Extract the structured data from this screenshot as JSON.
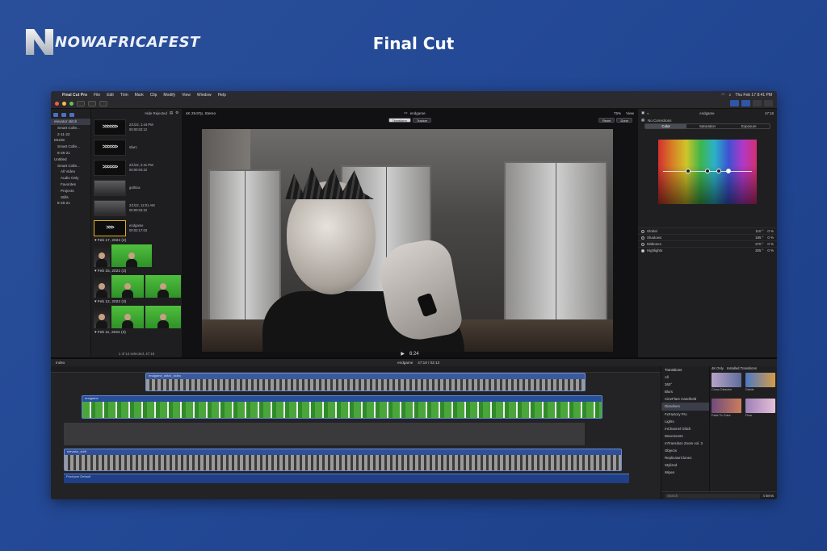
{
  "brand": {
    "name": "NOWAFRICAFEST"
  },
  "page_title": "Final Cut",
  "menubar": {
    "app": "Final Cut Pro",
    "items": [
      "File",
      "Edit",
      "Trim",
      "Mark",
      "Clip",
      "Modify",
      "View",
      "Window",
      "Help"
    ],
    "clock": "Thu Feb 17  8:41 PM"
  },
  "libraries": {
    "rows": [
      {
        "label": "elevator stitch",
        "indent": 0,
        "selected": true
      },
      {
        "label": "Smart Colle...",
        "indent": 1
      },
      {
        "label": "2-11-22",
        "indent": 1
      },
      {
        "label": "MUSE",
        "indent": 0
      },
      {
        "label": "Smart Colle...",
        "indent": 1
      },
      {
        "label": "8-26-21",
        "indent": 1
      },
      {
        "label": "Untitled",
        "indent": 0
      },
      {
        "label": "Smart Colle...",
        "indent": 1
      },
      {
        "label": "All Video",
        "indent": 2
      },
      {
        "label": "Audio Only",
        "indent": 2
      },
      {
        "label": "Favorites",
        "indent": 2
      },
      {
        "label": "Projects",
        "indent": 2
      },
      {
        "label": "Stills",
        "indent": 2
      },
      {
        "label": "8-26-21",
        "indent": 1
      }
    ]
  },
  "browser": {
    "filter": "Hide Rejected",
    "clips": [
      {
        "kind": "chev",
        "name": "2/1/22, 1:44 PM",
        "dur": "00:00:02:12"
      },
      {
        "kind": "chev",
        "name": "sfwrc"
      },
      {
        "kind": "chev",
        "name": "2/1/22, 2:41 PM",
        "dur": "00:00:04:22"
      },
      {
        "kind": "face",
        "name": "gothica"
      },
      {
        "kind": "face",
        "name": "2/1/22, 12:01 AM",
        "dur": "00:00:04:22"
      },
      {
        "kind": "sel",
        "name": "endgame",
        "dur": "00:02:17:03"
      }
    ],
    "groups": [
      {
        "date": "Feb 17, 2022",
        "count": "(2)",
        "captions": [
          "sn_up",
          "endgame"
        ]
      },
      {
        "date": "Feb 15, 2022",
        "count": "(3)",
        "captions": [
          "",
          "gothica",
          ""
        ]
      },
      {
        "date": "Feb 12, 2022",
        "count": "(3)",
        "captions": [
          "sn_up",
          "C0094",
          ""
        ]
      },
      {
        "date": "Feb 11, 2022",
        "count": "(3)",
        "captions": []
      }
    ],
    "footer": "1 of 14 selected, 47:18"
  },
  "viewer": {
    "format": "4K 29.97p, Stereo",
    "clip_name": "endgame",
    "zoom": "75%",
    "view_label": "View",
    "modes": [
      "Transform",
      "Tracker"
    ],
    "reset": "Reset",
    "done": "Done",
    "timecode": "6:24"
  },
  "inspector": {
    "clip_name": "endgame",
    "duration": "47:18",
    "correction": "No Corrections",
    "tabs": [
      "Color",
      "Saturation",
      "Exposure"
    ],
    "params": [
      {
        "label": "Global",
        "angle": "110 °",
        "pct": "0  %"
      },
      {
        "label": "Shadows",
        "angle": "185 °",
        "pct": "0  %"
      },
      {
        "label": "Midtones",
        "angle": "270 °",
        "pct": "0  %"
      },
      {
        "label": "Highlights",
        "angle": "305 °",
        "pct": "0  %"
      }
    ]
  },
  "timeline": {
    "index": "Index",
    "project": "endgame",
    "duration": "47:18 / 02:13",
    "tracks": [
      {
        "label": "endgame_stitch_video"
      },
      {
        "label": "endgame"
      },
      {
        "label": "elevator_shift"
      },
      {
        "label": "Producer Default"
      }
    ]
  },
  "transitions": {
    "title": "Transitions",
    "filter_label": "4K Only",
    "installed": "Installed Transitions",
    "categories": [
      "All",
      "360°",
      "Blurs",
      "CineFlare Handheld",
      "Dissolves",
      "FxFactory Pro",
      "Lights",
      "mChannel Glitch",
      "Movements",
      "mTransition Zoom vol. 3",
      "Objects",
      "ReplicatorClones",
      "Stylized",
      "Wipes"
    ],
    "selected_category": "Dissolves",
    "items": [
      {
        "name": "Cross Dissolve",
        "color1": "#b8a3c8",
        "color2": "#5e6d9c"
      },
      {
        "name": "Divide",
        "color1": "#4d79c5",
        "color2": "#d49a4a"
      },
      {
        "name": "Fade To Color",
        "color1": "#6f4b7e",
        "color2": "#cb7e5a"
      },
      {
        "name": "Flow",
        "color1": "#9d7fb6",
        "color2": "#e6c0d8"
      }
    ],
    "search_placeholder": "Search",
    "count": "4 items"
  }
}
